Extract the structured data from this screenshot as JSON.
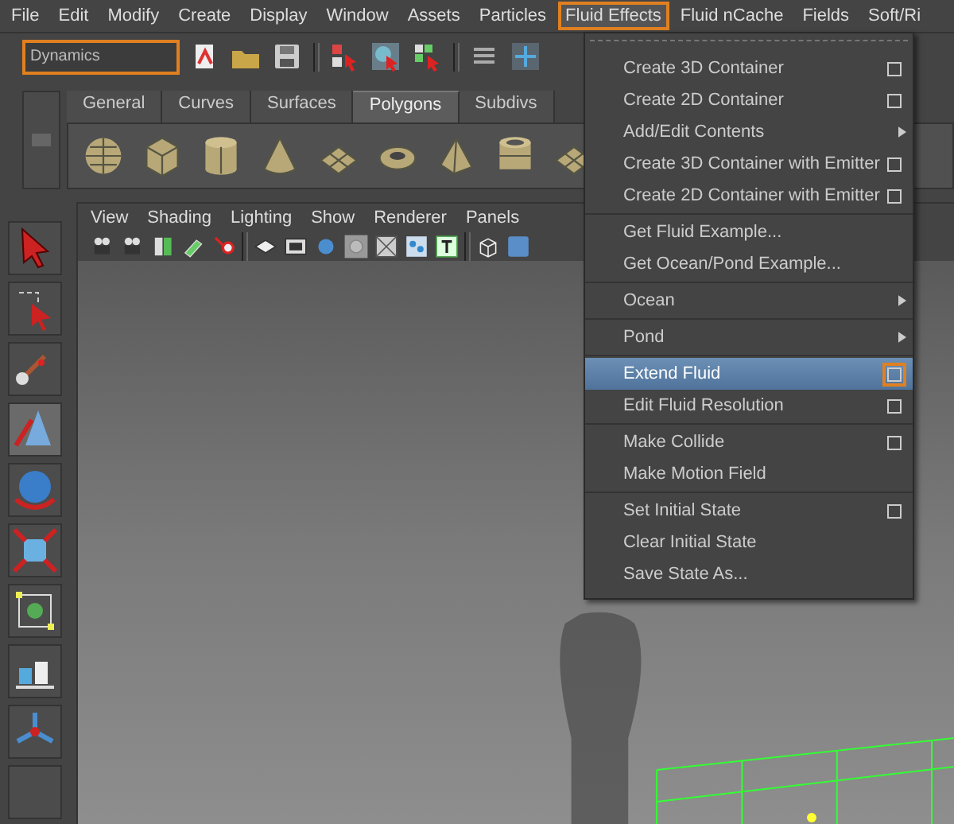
{
  "menu_bar": [
    {
      "label": "File",
      "selected": false
    },
    {
      "label": "Edit",
      "selected": false
    },
    {
      "label": "Modify",
      "selected": false
    },
    {
      "label": "Create",
      "selected": false
    },
    {
      "label": "Display",
      "selected": false
    },
    {
      "label": "Window",
      "selected": false
    },
    {
      "label": "Assets",
      "selected": false
    },
    {
      "label": "Particles",
      "selected": false
    },
    {
      "label": "Fluid Effects",
      "selected": true
    },
    {
      "label": "Fluid nCache",
      "selected": false
    },
    {
      "label": "Fields",
      "selected": false
    },
    {
      "label": "Soft/Ri",
      "selected": false
    }
  ],
  "status_line": {
    "mode_dropdown": "Dynamics"
  },
  "shelf_tabs": [
    {
      "label": "General",
      "selected": false
    },
    {
      "label": "Curves",
      "selected": false
    },
    {
      "label": "Surfaces",
      "selected": false
    },
    {
      "label": "Polygons",
      "selected": true
    },
    {
      "label": "Subdivs",
      "selected": false
    }
  ],
  "panel_menu": [
    "View",
    "Shading",
    "Lighting",
    "Show",
    "Renderer",
    "Panels"
  ],
  "dropdown_menu": {
    "sections": [
      [
        {
          "label": "Create 3D Container",
          "kind": "option",
          "selected": false
        },
        {
          "label": "Create 2D Container",
          "kind": "option",
          "selected": false
        },
        {
          "label": "Add/Edit Contents",
          "kind": "submenu",
          "selected": false
        },
        {
          "label": "Create 3D Container with Emitter",
          "kind": "option",
          "selected": false
        },
        {
          "label": "Create 2D Container with Emitter",
          "kind": "option",
          "selected": false
        }
      ],
      [
        {
          "label": "Get Fluid Example...",
          "kind": "plain",
          "selected": false
        },
        {
          "label": "Get Ocean/Pond Example...",
          "kind": "plain",
          "selected": false
        }
      ],
      [
        {
          "label": "Ocean",
          "kind": "submenu",
          "selected": false
        }
      ],
      [
        {
          "label": "Pond",
          "kind": "submenu",
          "selected": false
        }
      ],
      [
        {
          "label": "Extend Fluid",
          "kind": "option",
          "selected": true
        },
        {
          "label": "Edit Fluid Resolution",
          "kind": "option",
          "selected": false
        }
      ],
      [
        {
          "label": "Make Collide",
          "kind": "option",
          "selected": false
        },
        {
          "label": "Make Motion Field",
          "kind": "plain",
          "selected": false
        }
      ],
      [
        {
          "label": "Set Initial State",
          "kind": "option",
          "selected": false
        },
        {
          "label": "Clear Initial State",
          "kind": "plain",
          "selected": false
        },
        {
          "label": "Save State As...",
          "kind": "plain",
          "selected": false
        }
      ]
    ]
  }
}
